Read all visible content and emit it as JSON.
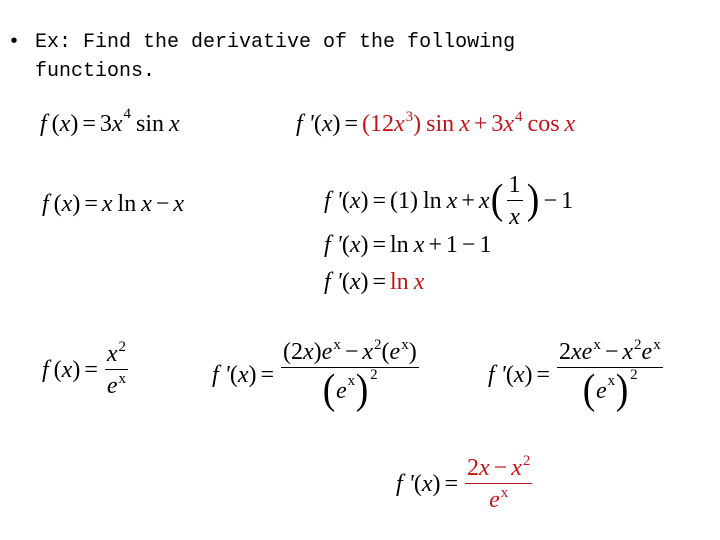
{
  "heading": {
    "bullet": "•",
    "line1": "Ex: Find the derivative of the following",
    "line2": "functions."
  },
  "colors": {
    "answer": "#c0141c",
    "text": "#000000"
  },
  "examples": [
    {
      "function": "f(x) = 3x^4 sin x",
      "steps": [
        "f'(x) = (12x^3) sin x + 3x^4 cos x"
      ],
      "answer": "(12x^3) sin x + 3x^4 cos x"
    },
    {
      "function": "f(x) = x ln x − x",
      "steps": [
        "f'(x) = (1) ln x + x(1/x) − 1",
        "f'(x) = ln x + 1 − 1",
        "f'(x) = ln x"
      ],
      "answer": "ln x"
    },
    {
      "function": "f(x) = x^2 / e^x",
      "steps": [
        "f'(x) = ((2x)e^x − x^2(e^x)) / (e^x)^2",
        "f'(x) = (2xe^x − x^2e^x) / (e^x)^2",
        "f'(x) = (2x − x^2) / e^x"
      ],
      "answer": "(2x − x^2) / e^x"
    }
  ],
  "sym": {
    "f": "f",
    "fp": "f '",
    "x": "x",
    "lp": "(",
    "rp": ")",
    "eq": "=",
    "plus": "+",
    "minus": "−",
    "three": "3",
    "four": "4",
    "two": "2",
    "one": "1",
    "twelve": "12",
    "sin": "sin",
    "cos": "cos",
    "ln": "ln",
    "e": "e",
    "one_paren": "(1)",
    "two_x_paren": "(2x)",
    "two_x": "2x"
  }
}
